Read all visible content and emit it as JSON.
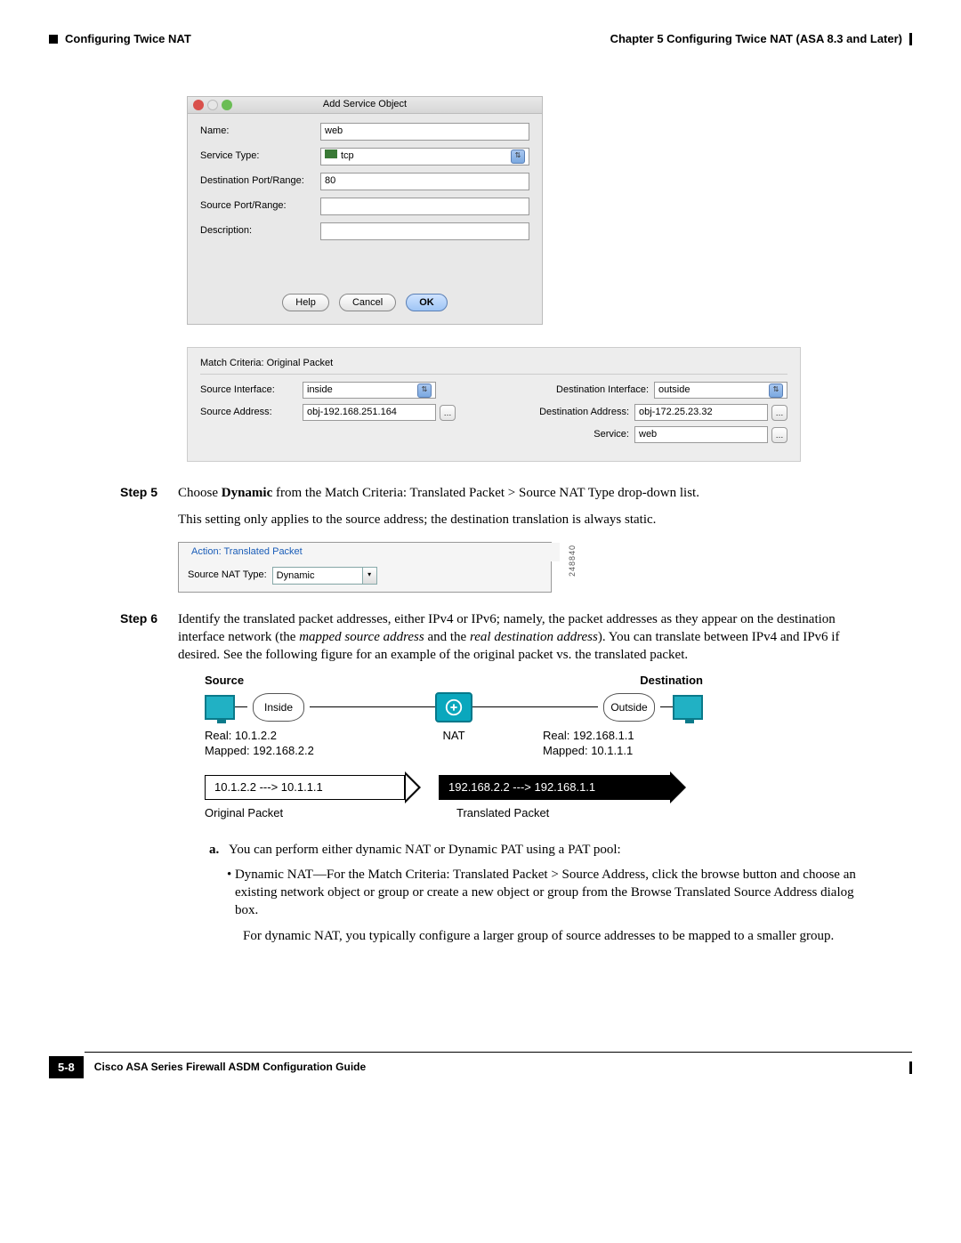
{
  "header": {
    "section": "Configuring Twice NAT",
    "chapter": "Chapter 5    Configuring Twice NAT (ASA 8.3 and Later)"
  },
  "dialog": {
    "title": "Add Service Object",
    "labels": {
      "name": "Name:",
      "service_type": "Service Type:",
      "dest_port": "Destination Port/Range:",
      "src_port": "Source Port/Range:",
      "description": "Description:"
    },
    "values": {
      "name": "web",
      "service_type": "tcp",
      "dest_port": "80",
      "src_port": "",
      "description": ""
    },
    "buttons": {
      "help": "Help",
      "cancel": "Cancel",
      "ok": "OK"
    }
  },
  "panel": {
    "title": "Match Criteria: Original Packet",
    "labels": {
      "src_if": "Source Interface:",
      "dst_if": "Destination Interface:",
      "src_addr": "Source Address:",
      "dst_addr": "Destination Address:",
      "service": "Service:"
    },
    "values": {
      "src_if": "inside",
      "dst_if": "outside",
      "src_addr": "obj-192.168.251.164",
      "dst_addr": "obj-172.25.23.32",
      "service": "web"
    }
  },
  "steps": {
    "s5": {
      "label": "Step 5",
      "text": "Choose Dynamic from the Match Criteria: Translated Packet > Source NAT Type drop-down list.",
      "follow": "This setting only applies to the source address; the destination translation is always static."
    },
    "s6": {
      "label": "Step 6",
      "text": "Identify the translated packet addresses, either IPv4 or IPv6; namely, the packet addresses as they appear on the destination interface network (the mapped source address and the real destination address). You can translate between IPv4 and IPv6 if desired. See the following figure for an example of the original packet vs. the translated packet."
    }
  },
  "action": {
    "legend": "Action: Translated Packet",
    "label": "Source NAT Type:",
    "value": "Dynamic",
    "fig_id": "248840"
  },
  "diagram": {
    "source": "Source",
    "destination": "Destination",
    "inside": "Inside",
    "outside": "Outside",
    "nat": "NAT",
    "real_left": "Real: 10.1.2.2",
    "mapped_left": "Mapped: 192.168.2.2",
    "real_right": "Real: 192.168.1.1",
    "mapped_right": "Mapped: 10.1.1.1",
    "arrow_left": "10.1.2.2 ---> 10.1.1.1",
    "arrow_right": "192.168.2.2 ---> 192.168.1.1",
    "orig_label": "Original Packet",
    "trans_label": "Translated Packet"
  },
  "sub": {
    "a_letter": "a.",
    "a_text": "You can perform either dynamic NAT or Dynamic PAT using a PAT pool:",
    "bullet1": "Dynamic NAT—For the Match Criteria: Translated Packet > Source Address, click the browse button and choose an existing network object or group or create a new object or group from the Browse Translated Source Address dialog box.",
    "bullet1_follow": "For dynamic NAT, you typically configure a larger group of source addresses to be mapped to a smaller group."
  },
  "footer": {
    "page": "5-8",
    "title": "Cisco ASA Series Firewall ASDM Configuration Guide"
  }
}
